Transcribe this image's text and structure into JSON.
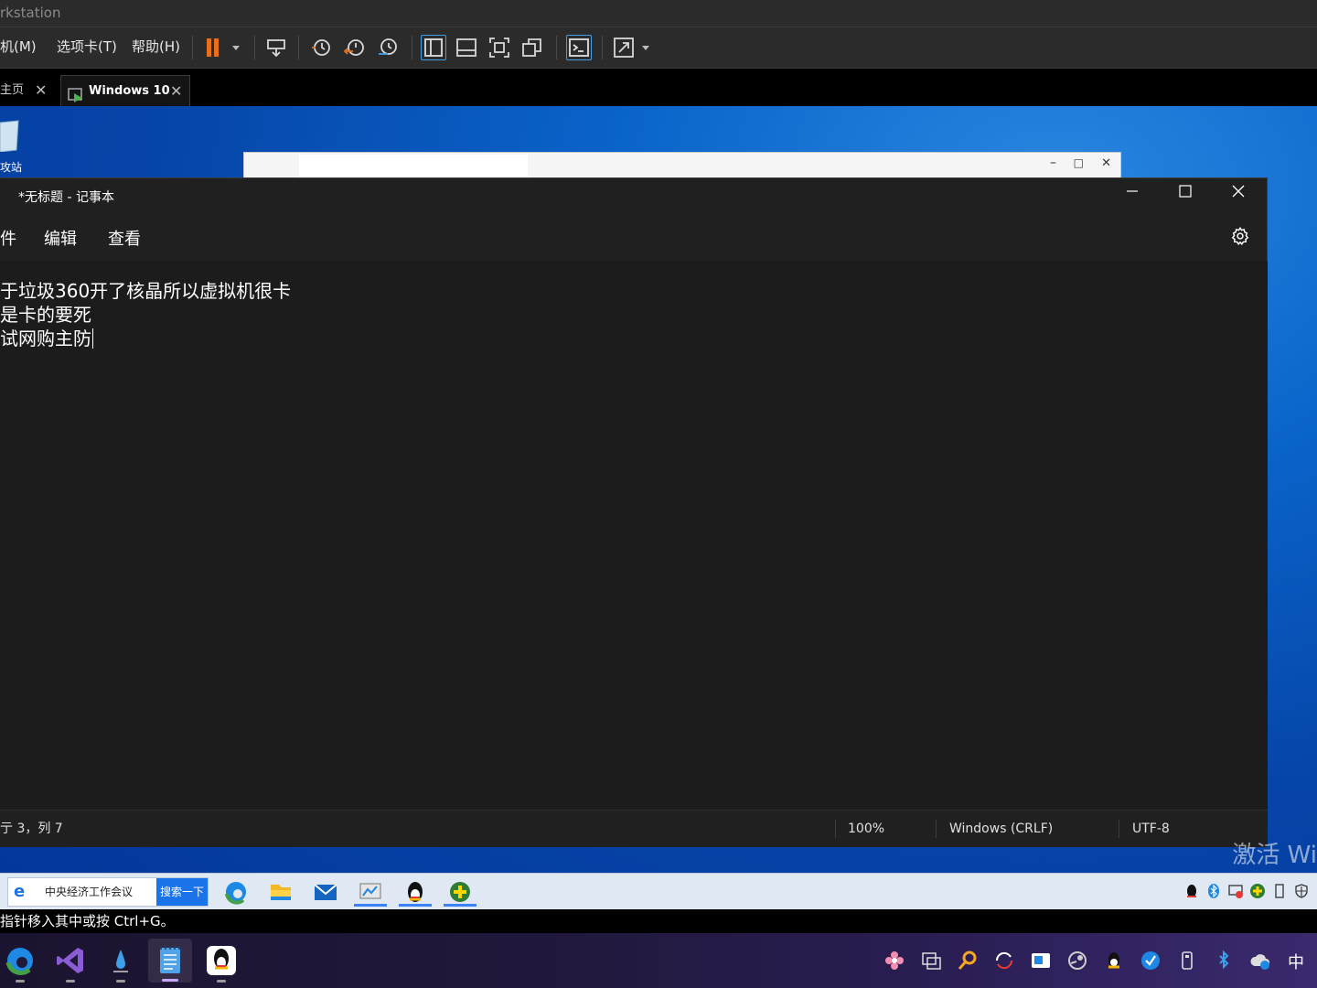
{
  "host": {
    "title": "rkstation",
    "menu": [
      {
        "label": "机(M)"
      },
      {
        "label": "选项卡(T)"
      },
      {
        "label": "帮助(H)"
      }
    ],
    "tabs": [
      {
        "label": "主页"
      },
      {
        "label": "Windows 10"
      }
    ],
    "hint": "指针移入其中或按 Ctrl+G。",
    "accent": "#e8701a"
  },
  "notepad": {
    "title": "*无标题 - 记事本",
    "menu": [
      "件",
      "编辑",
      "查看"
    ],
    "lines": [
      "于垃圾360开了核晶所以虚拟机很卡",
      "是卡的要死",
      "试网购主防"
    ],
    "status": {
      "position": "亍 3，列 7",
      "zoom": "100%",
      "line_ending": "Windows (CRLF)",
      "encoding": "UTF-8"
    }
  },
  "desktop": {
    "recycle_label": "攻站",
    "watermark": "激活 Wi"
  },
  "guest_taskbar": {
    "search_text": "中央经济工作会议",
    "search_button": "搜索一下"
  },
  "host_taskbar": {
    "ime": "中"
  }
}
